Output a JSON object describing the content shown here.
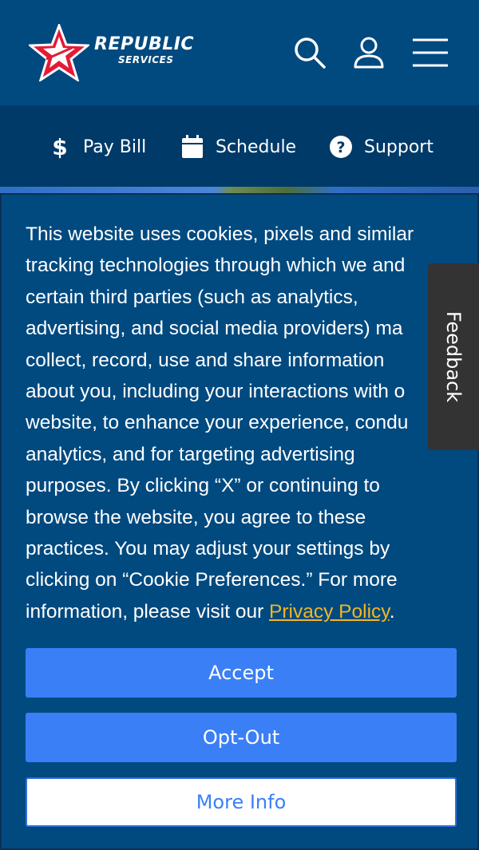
{
  "header": {
    "logo": {
      "word": "REPUBLIC",
      "sub": "SERVICES",
      "reg": "®"
    },
    "icons": [
      "search-icon",
      "user-icon",
      "menu-icon"
    ]
  },
  "quicknav": {
    "items": [
      {
        "label": "Pay Bill",
        "icon": "dollar-icon"
      },
      {
        "label": "Schedule",
        "icon": "calendar-icon"
      },
      {
        "label": "Support",
        "icon": "help-icon"
      }
    ]
  },
  "cookie_banner": {
    "lines": [
      "This website uses cookies, pixels and similar",
      "tracking technologies through which we and",
      "certain third parties (such as analytics,",
      "advertising, and social media providers) ma",
      "collect, record, use and share information",
      "about you, including your interactions with o",
      "website, to enhance your experience, condu",
      "analytics, and for targeting advertising",
      "purposes. By clicking “X” or continuing to",
      "browse the website, you agree to these",
      "practices. You may adjust your settings by",
      "clicking on “Cookie Preferences.” For more"
    ],
    "last_line_prefix": "information, please visit our ",
    "privacy_link": "Privacy Policy",
    "last_line_suffix": ".",
    "accept_label": "Accept",
    "optout_label": "Opt-Out",
    "moreinfo_label": "More Info",
    "link_color": "#f2b623",
    "button_color": "#3a7ff6"
  },
  "feedback_tab": {
    "label": "Feedback"
  }
}
